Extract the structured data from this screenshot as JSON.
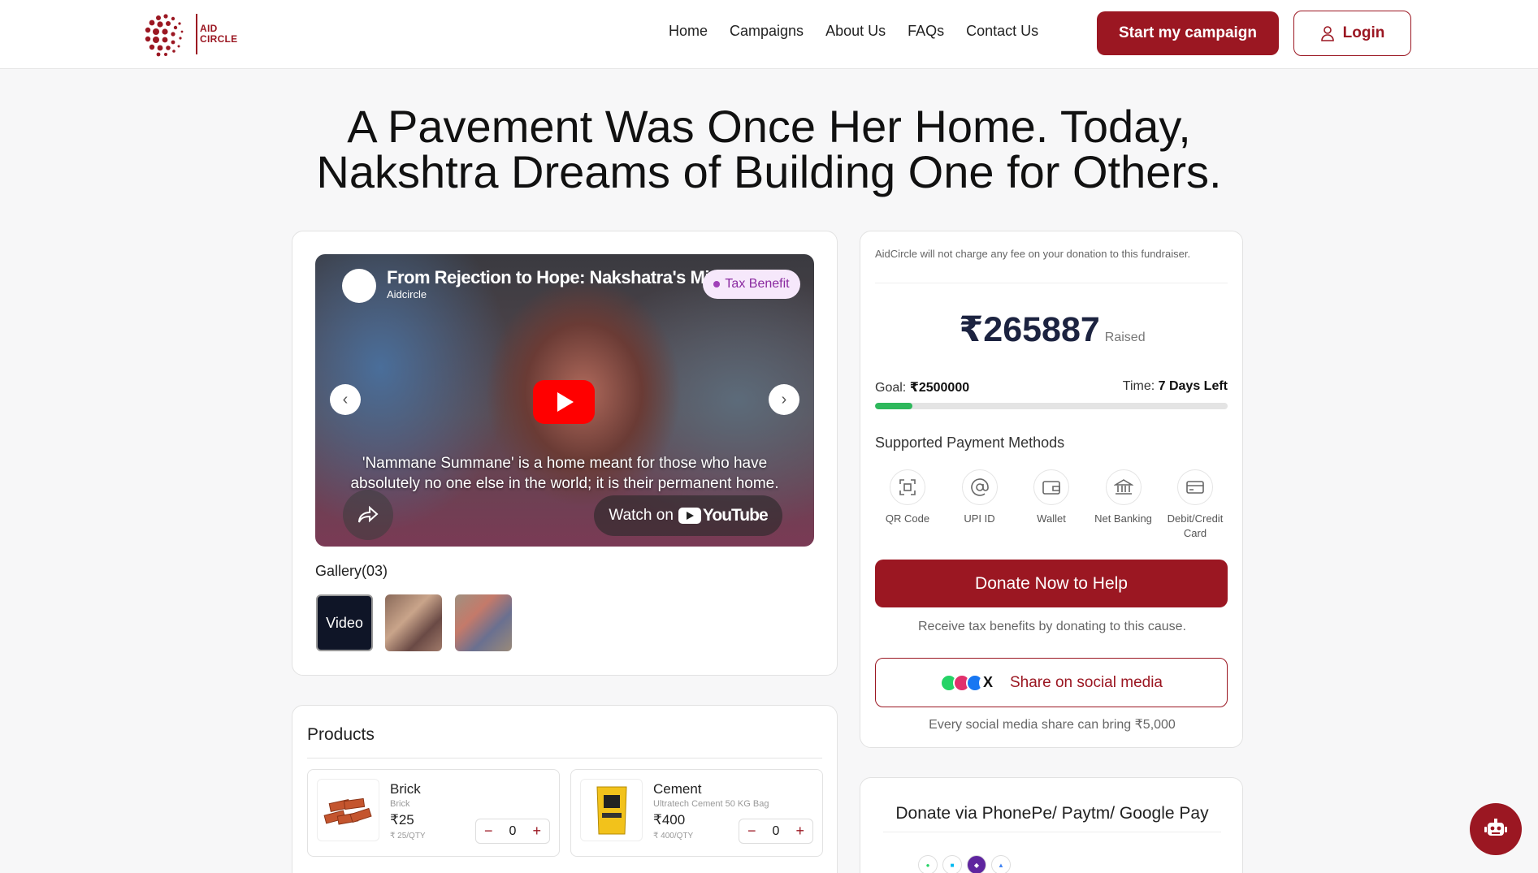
{
  "brand": {
    "logo_line1": "AID",
    "logo_line2": "CIRCLE",
    "primary_color": "#9b1722"
  },
  "nav": {
    "items": [
      "Home",
      "Campaigns",
      "About Us",
      "FAQs",
      "Contact Us"
    ]
  },
  "header": {
    "start_campaign": "Start my campaign",
    "login": "Login"
  },
  "page": {
    "title_line1": "A Pavement Was Once Her Home. Today,",
    "title_line2": "Nakshtra Dreams of Building One for Others."
  },
  "video": {
    "title": "From Rejection to Hope: Nakshatra's Mi",
    "channel": "Aidcircle",
    "badge": "Tax Benefit",
    "caption": "'Nammane Summane' is a home meant for those who have absolutely no one else in the world; it is their permanent home.",
    "watch_on": "Watch on",
    "youtube": "YouTube"
  },
  "gallery": {
    "label": "Gallery(03)",
    "video_thumb": "Video"
  },
  "products": {
    "title": "Products",
    "items": [
      {
        "name": "Brick",
        "sub": "Brick",
        "price": "₹25",
        "unit": "₹ 25/QTY",
        "qty": "0"
      },
      {
        "name": "Cement",
        "sub": "Ultratech Cement 50 KG Bag",
        "price": "₹400",
        "unit": "₹ 400/QTY",
        "qty": "0"
      }
    ]
  },
  "donation": {
    "fee_note": "AidCircle will not charge any fee on your donation to this fundraiser.",
    "raised": "₹265887",
    "raised_label": "Raised",
    "goal_label": "Goal:",
    "goal": "₹2500000",
    "time_label": "Time:",
    "time": "7 Days Left",
    "progress_fraction": 0.106,
    "progress_color": "#2eb85c",
    "payment_title": "Supported Payment Methods",
    "payment_methods": [
      {
        "label": "QR Code",
        "icon": "qr-scan-icon"
      },
      {
        "label": "UPI ID",
        "icon": "at-sign-icon"
      },
      {
        "label": "Wallet",
        "icon": "wallet-icon"
      },
      {
        "label": "Net Banking",
        "icon": "bank-icon"
      },
      {
        "label": "Debit/Credit Card",
        "icon": "card-icon"
      }
    ],
    "donate_button": "Donate Now to Help",
    "tax_note": "Receive tax benefits by donating to this cause.",
    "share_button": "Share on social media",
    "share_note": "Every social media share can bring ₹5,000"
  },
  "upi": {
    "title": "Donate via PhonePe/ Paytm/ Google Pay"
  }
}
